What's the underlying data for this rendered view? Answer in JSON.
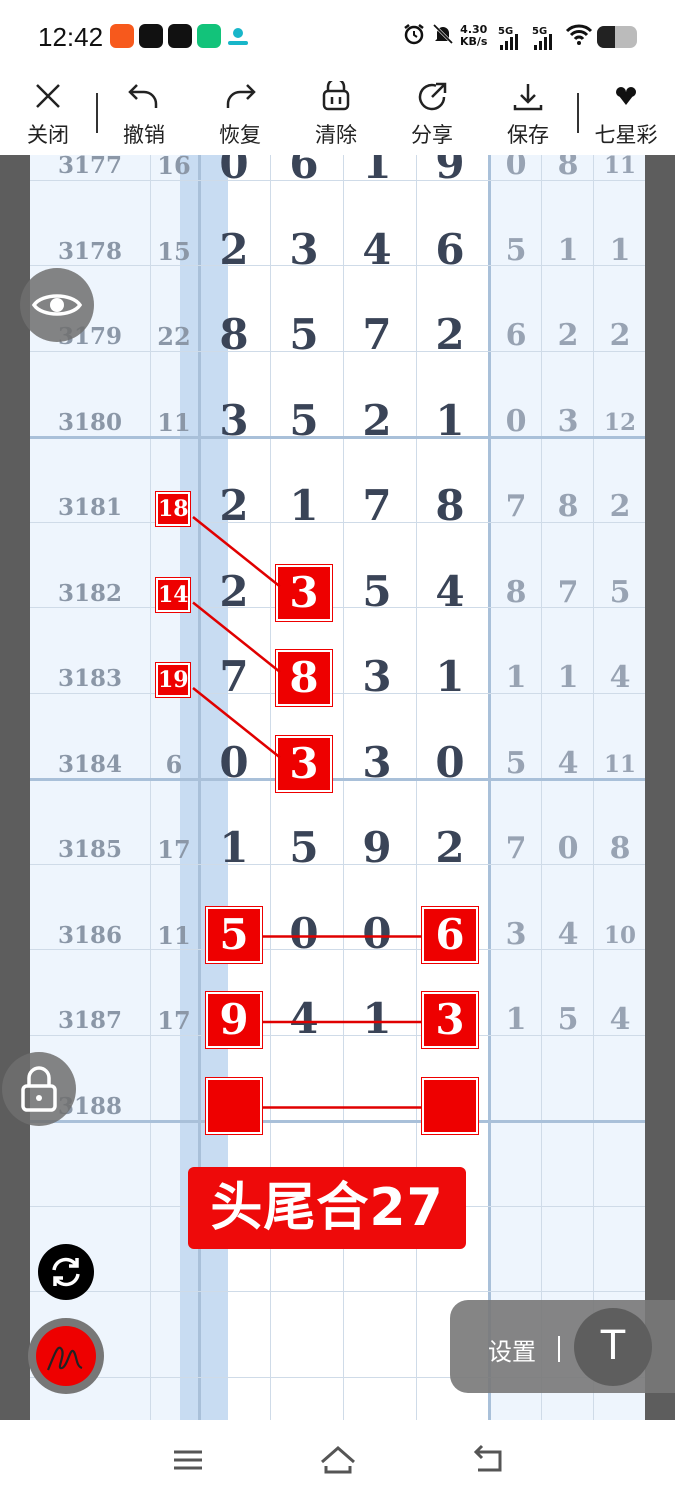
{
  "status": {
    "time": "12:42",
    "speed_top": "4.30",
    "speed_unit": "KB/s",
    "net1": "5G",
    "net2": "5G",
    "battery_level": 0.45
  },
  "toolbar": {
    "close": "关闭",
    "undo": "撤销",
    "redo": "恢复",
    "clear": "清除",
    "share": "分享",
    "save": "保存",
    "lottery": "七星彩"
  },
  "table": {
    "rows": [
      {
        "period": "3177",
        "sum": "16",
        "d": [
          "0",
          "6",
          "1",
          "9"
        ],
        "s": [
          "0",
          "8",
          "11"
        ]
      },
      {
        "period": "3178",
        "sum": "15",
        "d": [
          "2",
          "3",
          "4",
          "6"
        ],
        "s": [
          "5",
          "1",
          "1"
        ]
      },
      {
        "period": "3179",
        "sum": "22",
        "d": [
          "8",
          "5",
          "7",
          "2"
        ],
        "s": [
          "6",
          "2",
          "2"
        ]
      },
      {
        "period": "3180",
        "sum": "11",
        "d": [
          "3",
          "5",
          "2",
          "1"
        ],
        "s": [
          "0",
          "3",
          "12"
        ]
      },
      {
        "period": "3181",
        "sum": "18",
        "d": [
          "2",
          "1",
          "7",
          "8"
        ],
        "s": [
          "7",
          "8",
          "2"
        ]
      },
      {
        "period": "3182",
        "sum": "14",
        "d": [
          "2",
          "3",
          "5",
          "4"
        ],
        "s": [
          "8",
          "7",
          "5"
        ]
      },
      {
        "period": "3183",
        "sum": "19",
        "d": [
          "7",
          "8",
          "3",
          "1"
        ],
        "s": [
          "1",
          "1",
          "4"
        ]
      },
      {
        "period": "3184",
        "sum": "6",
        "d": [
          "0",
          "3",
          "3",
          "0"
        ],
        "s": [
          "5",
          "4",
          "11"
        ]
      },
      {
        "period": "3185",
        "sum": "17",
        "d": [
          "1",
          "5",
          "9",
          "2"
        ],
        "s": [
          "7",
          "0",
          "8"
        ]
      },
      {
        "period": "3186",
        "sum": "11",
        "d": [
          "5",
          "0",
          "0",
          "6"
        ],
        "s": [
          "3",
          "4",
          "10"
        ]
      },
      {
        "period": "3187",
        "sum": "17",
        "d": [
          "9",
          "4",
          "1",
          "3"
        ],
        "s": [
          "1",
          "5",
          "4"
        ]
      },
      {
        "period": "3188",
        "sum": "",
        "d": [
          "",
          "",
          "",
          ""
        ],
        "s": [
          "",
          "",
          ""
        ]
      }
    ],
    "highlight_sums": [
      4,
      5,
      6
    ],
    "highlight_digits": [
      [
        5,
        1
      ],
      [
        6,
        1
      ],
      [
        7,
        1
      ],
      [
        9,
        0
      ],
      [
        9,
        3
      ],
      [
        10,
        0
      ],
      [
        10,
        3
      ],
      [
        11,
        0
      ],
      [
        11,
        3
      ]
    ]
  },
  "banner": "头尾合27",
  "settings": {
    "label": "设置",
    "t_button": "T"
  },
  "colors": {
    "highlight_red": "#ee0000",
    "mid_column_blue": "#c8dcf2",
    "side_column_blue": "#eef5fd"
  },
  "icons": [
    "close-icon",
    "undo-icon",
    "redo-icon",
    "clear-icon",
    "share-icon",
    "save-icon",
    "heart-icon",
    "eye-icon",
    "lock-icon",
    "refresh-icon",
    "pen-icon",
    "menu-icon",
    "home-icon",
    "back-icon"
  ]
}
